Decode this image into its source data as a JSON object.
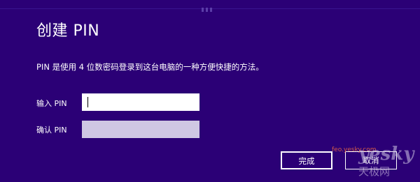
{
  "dialog": {
    "title": "创建 PIN",
    "description": "PIN 是使用 4 位数密码登录到这台电脑的一种方便快捷的方法。"
  },
  "form": {
    "pin_label": "输入 PIN",
    "pin_value": "",
    "confirm_label": "确认 PIN",
    "confirm_value": ""
  },
  "buttons": {
    "done_label": "完成",
    "cancel_label": "取消"
  },
  "watermark": {
    "site": "feo.yesky.com",
    "logo": "yesky",
    "cn": "天极网"
  },
  "colors": {
    "background": "#2b0076",
    "text": "#ffffff",
    "disabled_field": "#cfc7e3"
  }
}
